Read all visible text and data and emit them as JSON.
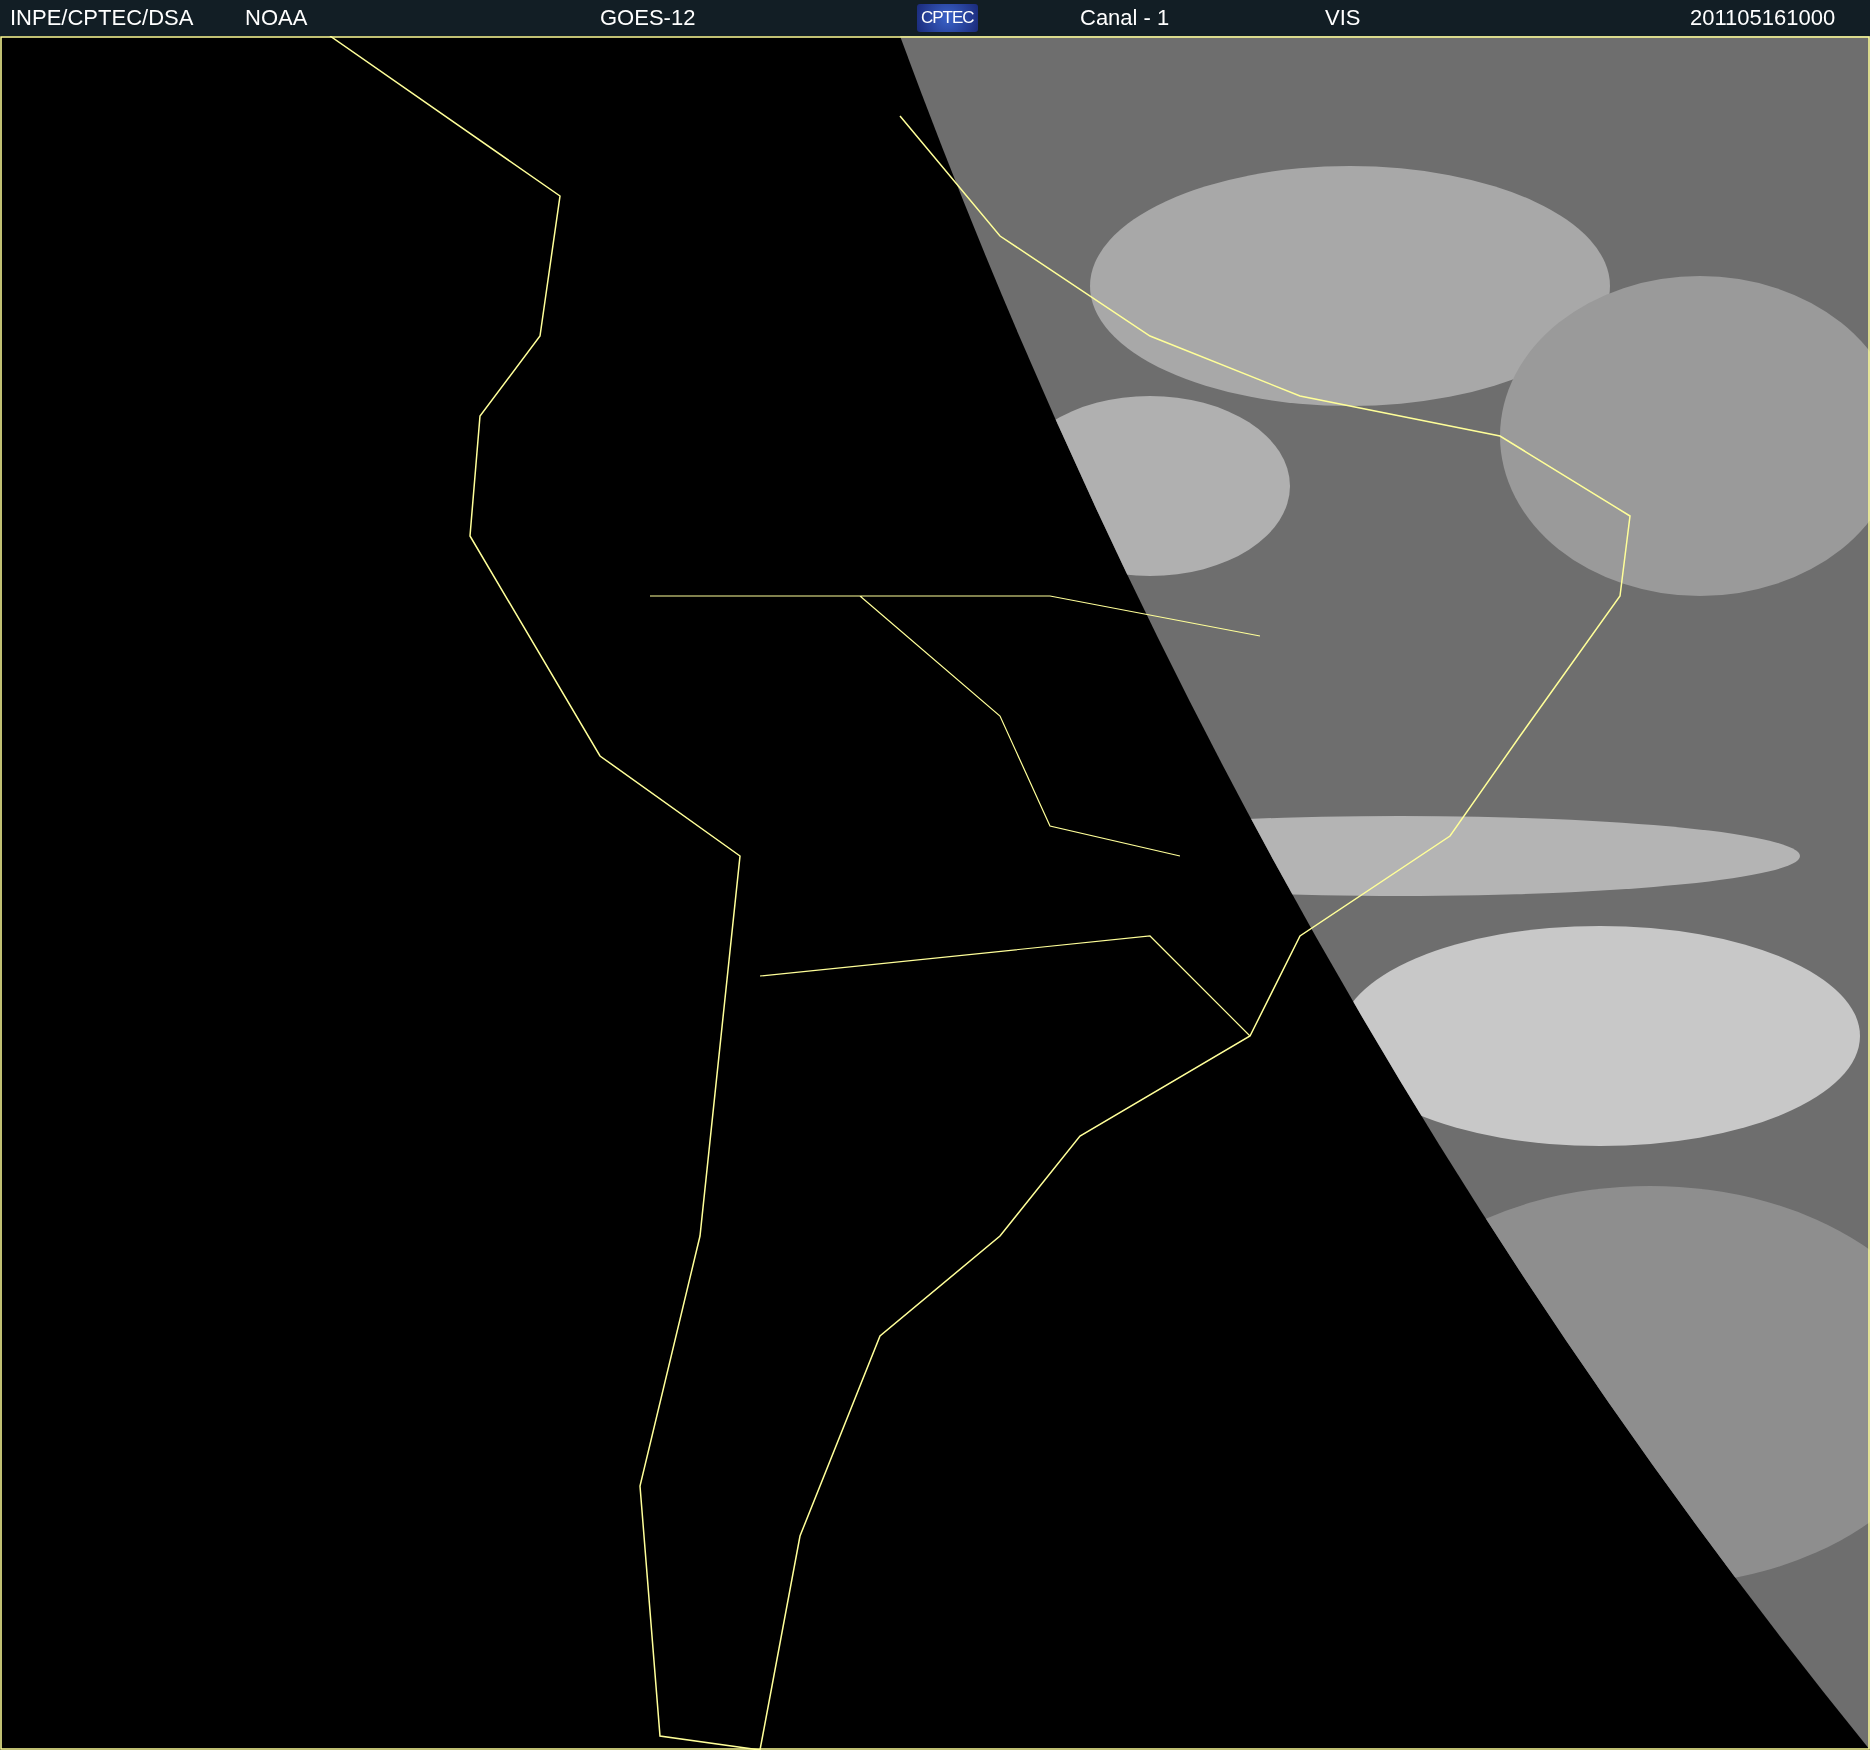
{
  "header": {
    "items": [
      {
        "kind": "text",
        "text": "INPE/CPTEC/DSA"
      },
      {
        "kind": "text",
        "text": "NOAA"
      },
      {
        "kind": "text",
        "text": "GOES-12"
      },
      {
        "kind": "logo",
        "text": "CPTEC"
      },
      {
        "kind": "text",
        "text": "Canal - 1"
      },
      {
        "kind": "text",
        "text": "VIS"
      },
      {
        "kind": "text",
        "text": "201105161000"
      }
    ]
  }
}
